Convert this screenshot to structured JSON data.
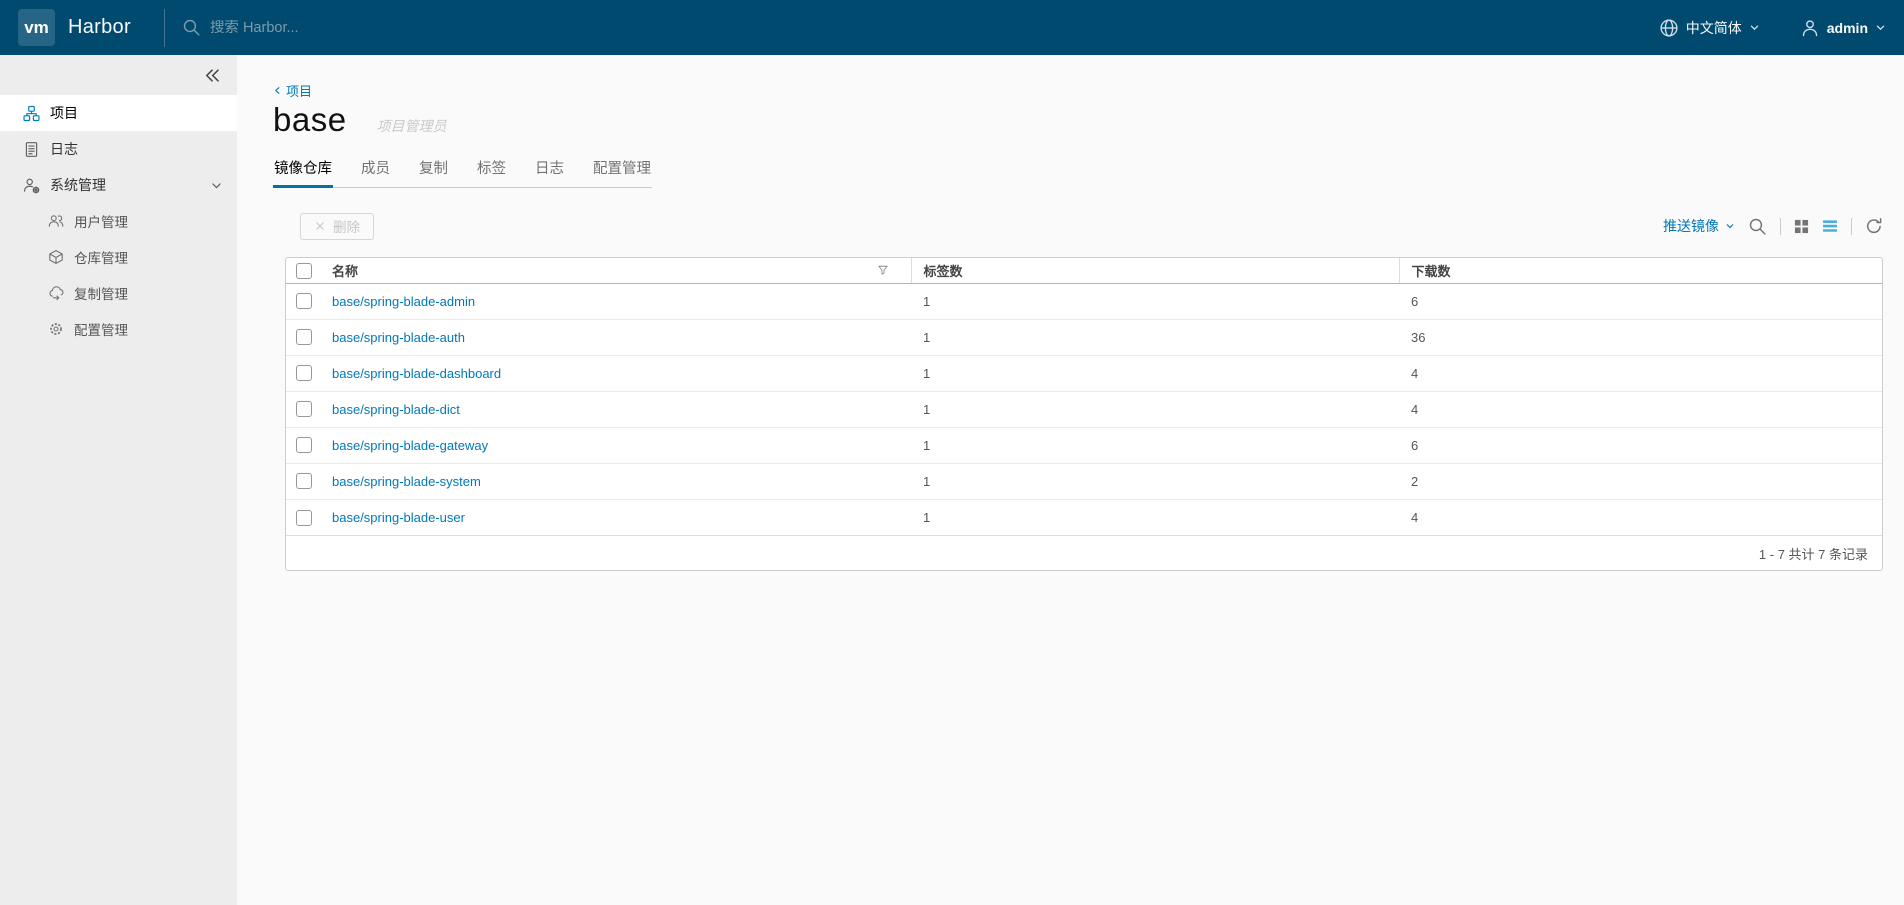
{
  "header": {
    "logo_text": "vm",
    "app_title": "Harbor",
    "search_placeholder": "搜索 Harbor...",
    "language_label": "中文简体",
    "username": "admin"
  },
  "sidebar": {
    "items": [
      {
        "label": "项目"
      },
      {
        "label": "日志"
      },
      {
        "label": "系统管理"
      }
    ],
    "subitems": [
      {
        "label": "用户管理"
      },
      {
        "label": "仓库管理"
      },
      {
        "label": "复制管理"
      },
      {
        "label": "配置管理"
      }
    ]
  },
  "page": {
    "breadcrumb_label": "项目",
    "title": "base",
    "role_badge": "项目管理员",
    "tabs": [
      {
        "label": "镜像仓库"
      },
      {
        "label": "成员"
      },
      {
        "label": "复制"
      },
      {
        "label": "标签"
      },
      {
        "label": "日志"
      },
      {
        "label": "配置管理"
      }
    ]
  },
  "toolbar": {
    "delete_label": "删除",
    "push_image_label": "推送镜像"
  },
  "table": {
    "columns": [
      {
        "label": "名称"
      },
      {
        "label": "标签数"
      },
      {
        "label": "下载数"
      }
    ],
    "rows": [
      {
        "name": "base/spring-blade-admin",
        "tags": "1",
        "pulls": "6"
      },
      {
        "name": "base/spring-blade-auth",
        "tags": "1",
        "pulls": "36"
      },
      {
        "name": "base/spring-blade-dashboard",
        "tags": "1",
        "pulls": "4"
      },
      {
        "name": "base/spring-blade-dict",
        "tags": "1",
        "pulls": "4"
      },
      {
        "name": "base/spring-blade-gateway",
        "tags": "1",
        "pulls": "6"
      },
      {
        "name": "base/spring-blade-system",
        "tags": "1",
        "pulls": "2"
      },
      {
        "name": "base/spring-blade-user",
        "tags": "1",
        "pulls": "4"
      }
    ],
    "footer_text": "1 - 7 共计 7 条记录"
  },
  "colors": {
    "header_bg": "#004a70",
    "sidebar_bg": "#ededed",
    "content_bg": "#fafafa",
    "link_blue": "#0079b8",
    "active_tab_underline": "#0072a3",
    "list_view_active_icon": "#49afd9"
  }
}
